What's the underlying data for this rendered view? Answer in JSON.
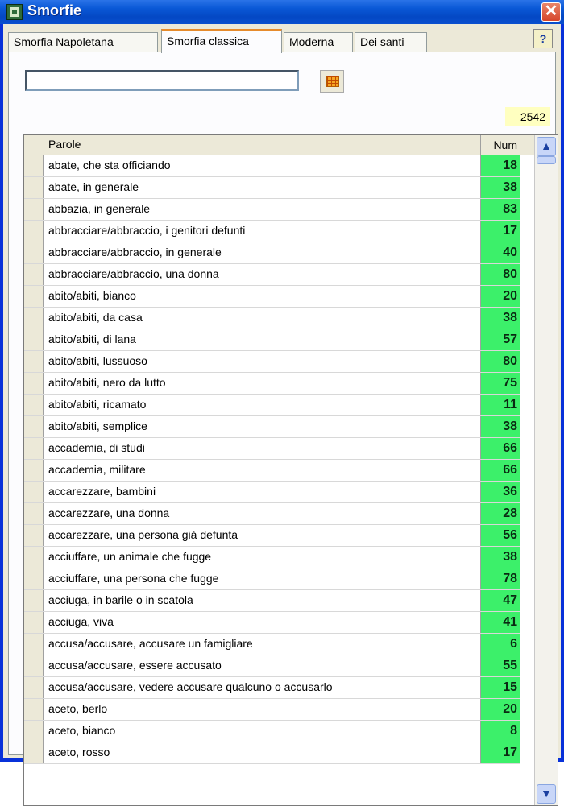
{
  "window": {
    "title": "Smorfie",
    "close_label": "✕"
  },
  "tabs": [
    {
      "label": "Smorfia Napoletana"
    },
    {
      "label": "Smorfia classica"
    },
    {
      "label": "Moderna"
    },
    {
      "label": "Dei santi"
    }
  ],
  "help_label": "?",
  "search": {
    "value": "",
    "placeholder": ""
  },
  "count": "2542",
  "columns": {
    "word": "Parole",
    "num": "Num"
  },
  "rows": [
    {
      "word": "abate, che sta officiando",
      "num": "18"
    },
    {
      "word": "abate, in generale",
      "num": "38"
    },
    {
      "word": "abbazia, in generale",
      "num": "83"
    },
    {
      "word": "abbracciare/abbraccio, i genitori defunti",
      "num": "17"
    },
    {
      "word": "abbracciare/abbraccio, in generale",
      "num": "40"
    },
    {
      "word": "abbracciare/abbraccio, una donna",
      "num": "80"
    },
    {
      "word": "abito/abiti, bianco",
      "num": "20"
    },
    {
      "word": "abito/abiti, da casa",
      "num": "38"
    },
    {
      "word": "abito/abiti, di lana",
      "num": "57"
    },
    {
      "word": "abito/abiti, lussuoso",
      "num": "80"
    },
    {
      "word": "abito/abiti, nero da lutto",
      "num": "75"
    },
    {
      "word": "abito/abiti, ricamato",
      "num": "11"
    },
    {
      "word": "abito/abiti, semplice",
      "num": "38"
    },
    {
      "word": "accademia, di studi",
      "num": "66"
    },
    {
      "word": "accademia, militare",
      "num": "66"
    },
    {
      "word": "accarezzare, bambini",
      "num": "36"
    },
    {
      "word": "accarezzare, una donna",
      "num": "28"
    },
    {
      "word": "accarezzare, una persona già defunta",
      "num": "56"
    },
    {
      "word": "acciuffare, un animale che fugge",
      "num": "38"
    },
    {
      "word": "acciuffare, una persona che fugge",
      "num": "78"
    },
    {
      "word": "acciuga, in barile o in scatola",
      "num": "47"
    },
    {
      "word": "acciuga, viva",
      "num": "41"
    },
    {
      "word": "accusa/accusare, accusare un famigliare",
      "num": "6"
    },
    {
      "word": "accusa/accusare, essere accusato",
      "num": "55"
    },
    {
      "word": "accusa/accusare, vedere accusare qualcuno o accusarlo",
      "num": "15"
    },
    {
      "word": "aceto, berlo",
      "num": "20"
    },
    {
      "word": "aceto, bianco",
      "num": "8"
    },
    {
      "word": "aceto, rosso",
      "num": "17"
    }
  ],
  "colors": {
    "num_bg": "#3cf06a",
    "titlebar": "#0448c4",
    "count_bg": "#ffffc0"
  }
}
